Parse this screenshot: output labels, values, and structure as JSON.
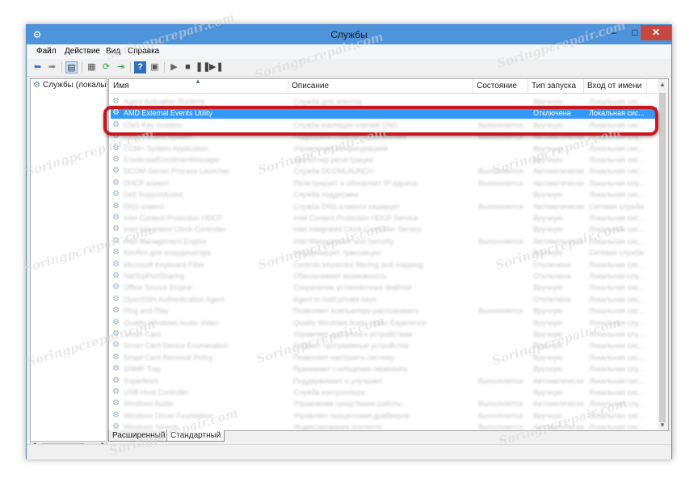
{
  "window": {
    "title": "Службы",
    "minimize": "–",
    "maximize": "□",
    "close": "✕"
  },
  "menu": [
    "Файл",
    "Действие",
    "Вид",
    "Справка"
  ],
  "toolbar_icons": [
    "back-arrow-icon",
    "forward-arrow-icon",
    "console-tree-icon",
    "properties-icon",
    "refresh-icon",
    "export-list-icon",
    "help-icon",
    "console-icon",
    "start-service-icon",
    "stop-service-icon",
    "pause-service-icon",
    "restart-service-icon"
  ],
  "tree": {
    "root_label": "Службы (локалы"
  },
  "columns": {
    "name": "Имя",
    "description": "Описание",
    "status": "Состояние",
    "startup": "Тип запуска",
    "logon": "Вход от имени"
  },
  "selected_row": {
    "name": "AMD External Events Utility",
    "description": "",
    "status": "",
    "startup": "Отключена",
    "logon": "Локальная сис..."
  },
  "rows": [
    {
      "name": "Agent Activation Runtime",
      "description": "Служба для агентов",
      "status": "",
      "startup": "Вручную",
      "logon": "Локальная сис..."
    },
    {
      "name": "AMD External Events Utility",
      "description": "",
      "status": "",
      "startup": "Отключена",
      "logon": "Локальная сис..."
    },
    {
      "name": "CNG Key Isolation",
      "description": "Служба изоляции ключей CNG",
      "status": "Выполняется",
      "startup": "Вручную",
      "logon": "Локальная сис..."
    },
    {
      "name": "COM+ Event System",
      "description": "Поддержка службы уведомления",
      "status": "Выполняется",
      "startup": "Автоматически",
      "logon": "Локальная слу..."
    },
    {
      "name": "COM+ System Application",
      "description": "Управление конфигурацией",
      "status": "",
      "startup": "Вручную",
      "logon": "Локальная сис..."
    },
    {
      "name": "CredentialEnrollmentManager",
      "description": "Диспетчер регистрации",
      "status": "",
      "startup": "Вручную",
      "logon": "Локальная сис..."
    },
    {
      "name": "DCOM Server Process Launcher",
      "description": "Служба DCOMLAUNCH",
      "status": "Выполняется",
      "startup": "Автоматически",
      "logon": "Локальная сис..."
    },
    {
      "name": "DHCP-клиент",
      "description": "Регистрирует и обновляет IP-адреса",
      "status": "Выполняется",
      "startup": "Автоматически",
      "logon": "Локальная слу..."
    },
    {
      "name": "Dell SupportAssist",
      "description": "Служба поддержки",
      "status": "",
      "startup": "Вручную",
      "logon": "Локальная сис..."
    },
    {
      "name": "DNS-клиент",
      "description": "Служба DNS-клиента кэширует",
      "status": "Выполняется",
      "startup": "Автоматически",
      "logon": "Сетевая служба"
    },
    {
      "name": "Intel Content Protection HDCP",
      "description": "Intel Content Protection HDCP Service",
      "status": "",
      "startup": "Вручную",
      "logon": "Локальная сис..."
    },
    {
      "name": "Intel Integrated Clock Controller",
      "description": "Intel Integrated Clock Controller Service",
      "status": "",
      "startup": "Вручную",
      "logon": "Локальная сис..."
    },
    {
      "name": "Intel Management Engine",
      "description": "Intel Management and Security",
      "status": "Выполняется",
      "startup": "Автоматически",
      "logon": "Локальная сис..."
    },
    {
      "name": "KtmRm для координатора",
      "description": "Координирует транзакции",
      "status": "",
      "startup": "Вручную",
      "logon": "Сетевая служба"
    },
    {
      "name": "Microsoft Keyboard Filter",
      "description": "Controls keystroke filtering and mapping",
      "status": "",
      "startup": "Отключена",
      "logon": "Локальная сис..."
    },
    {
      "name": "NetTcpPortSharing",
      "description": "Обеспечивает возможность",
      "status": "",
      "startup": "Отключена",
      "logon": "Локальная слу..."
    },
    {
      "name": "Office Source Engine",
      "description": "Сохранение установочных файлов",
      "status": "",
      "startup": "Вручную",
      "logon": "Локальная сис..."
    },
    {
      "name": "OpenSSH Authentication Agent",
      "description": "Agent to hold private keys",
      "status": "",
      "startup": "Отключена",
      "logon": "Локальная сис..."
    },
    {
      "name": "Plug and Play",
      "description": "Позволяет компьютеру распознавать",
      "status": "Выполняется",
      "startup": "Вручную",
      "logon": "Локальная сис..."
    },
    {
      "name": "Quality Windows Audio Video",
      "description": "Quality Windows Audio Video Experience",
      "status": "",
      "startup": "Вручную",
      "logon": "Локальная слу..."
    },
    {
      "name": "Smart Card",
      "description": "Управляет доступом к устройствам",
      "status": "",
      "startup": "Вручную",
      "logon": "Локальная слу..."
    },
    {
      "name": "Smart Card Device Enumeration",
      "description": "Создает программные устройства",
      "status": "",
      "startup": "Вручную",
      "logon": "Локальная сис..."
    },
    {
      "name": "Smart Card Removal Policy",
      "description": "Позволяет настроить систему",
      "status": "",
      "startup": "Вручную",
      "logon": "Локальная сис..."
    },
    {
      "name": "SNMP Trap",
      "description": "Принимает сообщения перехвата",
      "status": "",
      "startup": "Вручную",
      "logon": "Локальная слу..."
    },
    {
      "name": "Superfetch",
      "description": "Поддерживает и улучшает",
      "status": "Выполняется",
      "startup": "Автоматически",
      "logon": "Локальная сис..."
    },
    {
      "name": "USB Host Controller",
      "description": "Служба контроллера",
      "status": "",
      "startup": "Вручную",
      "logon": "Локальная сис..."
    },
    {
      "name": "Windows Audio",
      "description": "Управление средствами работы",
      "status": "Выполняется",
      "startup": "Автоматически",
      "logon": "Локальная слу..."
    },
    {
      "name": "Windows Driver Foundation",
      "description": "Управляет процессами драйверов",
      "status": "Выполняется",
      "startup": "Вручную",
      "logon": "Локальная сис..."
    },
    {
      "name": "Windows Search",
      "description": "Индексирование контента",
      "status": "Выполняется",
      "startup": "Автоматически",
      "logon": "Локальная сис..."
    }
  ],
  "tabs": [
    "Расширенный",
    "Стандартный"
  ],
  "watermark": "Soringpcrepair.com",
  "colors": {
    "titlebar": "#4e94db",
    "selection": "#3399ff",
    "highlight": "#c8161d",
    "close": "#c7463d"
  }
}
